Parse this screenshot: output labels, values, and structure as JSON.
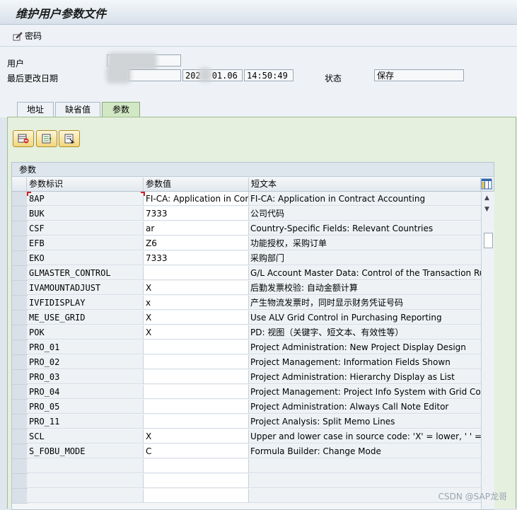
{
  "window": {
    "title": "维护用户参数文件"
  },
  "toolbar": {
    "password_label": "密码"
  },
  "form": {
    "user_label": "用户",
    "last_changed_label": "最后更改日期",
    "date_visible_prefix": "202",
    "date_visible_suffix": "01.06",
    "time": "14:50:49",
    "status_label": "状态",
    "status_value": "保存"
  },
  "tabs": [
    {
      "label": "地址",
      "active": false
    },
    {
      "label": "缺省值",
      "active": false
    },
    {
      "label": "参数",
      "active": true
    }
  ],
  "grid": {
    "title": "参数",
    "columns": [
      "参数标识",
      "参数值",
      "短文本"
    ],
    "rows": [
      {
        "id": "8AP",
        "value": "FI-CA: Application in Cont…",
        "text": "FI-CA: Application in Contract Accounting"
      },
      {
        "id": "BUK",
        "value": "7333",
        "text": "公司代码"
      },
      {
        "id": "CSF",
        "value": "ar",
        "text": "Country-Specific Fields: Relevant Countries"
      },
      {
        "id": "EFB",
        "value": "Z6",
        "text": "功能授权，采购订单"
      },
      {
        "id": "EKO",
        "value": "7333",
        "text": "采购部门"
      },
      {
        "id": "GLMASTER_CONTROL",
        "value": "",
        "text": "G/L Account Master Data: Control of the Transaction Run"
      },
      {
        "id": "IVAMOUNTADJUST",
        "value": "X",
        "text": "后勤发票校验: 自动金额计算"
      },
      {
        "id": "IVFIDISPLAY",
        "value": "x",
        "text": "产生物流发票时，同时显示财务凭证号码"
      },
      {
        "id": "ME_USE_GRID",
        "value": "X",
        "text": "Use ALV Grid Control in Purchasing Reporting"
      },
      {
        "id": "POK",
        "value": "X",
        "text": "PD: 视图（关键字、短文本、有效性等）"
      },
      {
        "id": "PRO_01",
        "value": "",
        "text": "Project Administration: New Project Display Design"
      },
      {
        "id": "PRO_02",
        "value": "",
        "text": "Project Management: Information Fields Shown"
      },
      {
        "id": "PRO_03",
        "value": "",
        "text": "Project Administration: Hierarchy Display as List"
      },
      {
        "id": "PRO_04",
        "value": "",
        "text": "Project Management: Project Info System with Grid Contro"
      },
      {
        "id": "PRO_05",
        "value": "",
        "text": "Project Administration: Always Call Note Editor"
      },
      {
        "id": "PRO_11",
        "value": "",
        "text": "Project Analysis: Split Memo Lines"
      },
      {
        "id": "SCL",
        "value": "X",
        "text": "Upper and lower case in source code: 'X' = lower, ' ' =upp"
      },
      {
        "id": "S_FOBU_MODE",
        "value": "C",
        "text": "Formula Builder: Change Mode"
      },
      {
        "id": "",
        "value": "",
        "text": ""
      },
      {
        "id": "",
        "value": "",
        "text": ""
      },
      {
        "id": "",
        "value": "",
        "text": ""
      }
    ]
  },
  "watermark": "CSDN @SAP龙哥",
  "colors": {
    "tab_active": "#d2e8c4",
    "panel": "#e5f0de",
    "button": "#f2d67b"
  }
}
